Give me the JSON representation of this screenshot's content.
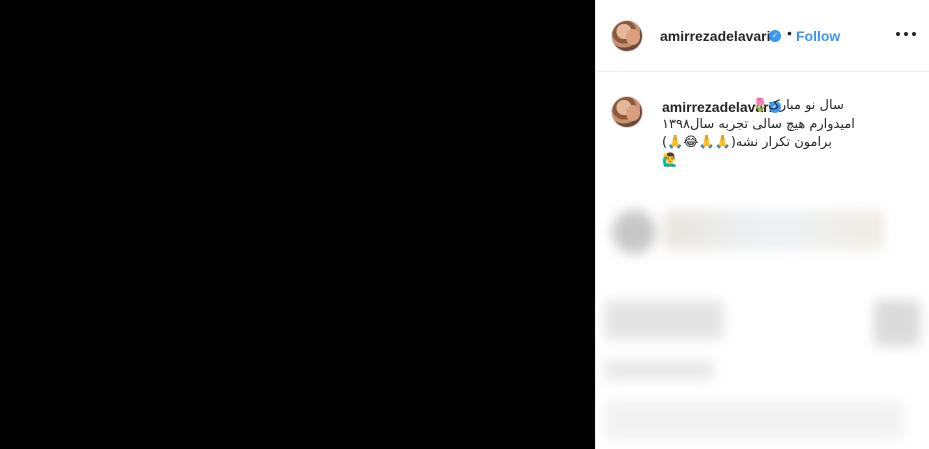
{
  "post": {
    "username": "amirrezadelavari",
    "follow_label": "Follow",
    "separator": "•",
    "verified_mark": "✓"
  },
  "caption": {
    "username": "amirrezadelavari",
    "line1": "🌷سال نو مبارک",
    "line2": "امیدوارم هیچ سالی تجربه سال۱۳۹۸",
    "line3": "(🙏😂🙏🙏)برامون تکرار نشه",
    "line4": "🙋‍♂️"
  }
}
